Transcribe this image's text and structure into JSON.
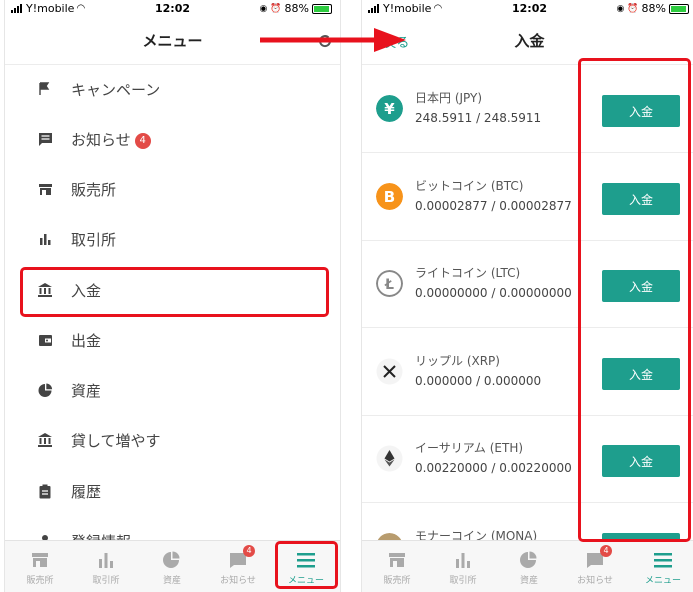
{
  "status": {
    "carrier": "Y!mobile",
    "time": "12:02",
    "battery": "88%"
  },
  "left": {
    "title": "メニュー",
    "items": [
      {
        "label": "キャンペーン",
        "icon": "flag-icon"
      },
      {
        "label": "お知らせ",
        "icon": "message-icon",
        "badge": "4"
      },
      {
        "label": "販売所",
        "icon": "store-icon"
      },
      {
        "label": "取引所",
        "icon": "bar-chart-icon"
      },
      {
        "label": "入金",
        "icon": "bank-icon"
      },
      {
        "label": "出金",
        "icon": "wallet-icon"
      },
      {
        "label": "資産",
        "icon": "pie-chart-icon"
      },
      {
        "label": "貸して増やす",
        "icon": "bank-icon"
      },
      {
        "label": "履歴",
        "icon": "clipboard-icon"
      },
      {
        "label": "登録情報",
        "icon": "person-icon"
      }
    ]
  },
  "right": {
    "back": "戻る",
    "title": "入金",
    "coins": [
      {
        "name": "日本円 (JPY)",
        "balance": "248.5911 / 248.5911",
        "button": "入金",
        "icon": "yen-icon",
        "color": "#1e9e8d"
      },
      {
        "name": "ビットコイン (BTC)",
        "balance": "0.00002877 / 0.00002877",
        "button": "入金",
        "icon": "bitcoin-icon",
        "color": "#f7931a"
      },
      {
        "name": "ライトコイン (LTC)",
        "balance": "0.00000000 / 0.00000000",
        "button": "入金",
        "icon": "litecoin-icon",
        "color": "#888888"
      },
      {
        "name": "リップル (XRP)",
        "balance": "0.000000 / 0.000000",
        "button": "入金",
        "icon": "xrp-icon",
        "color": "#222222"
      },
      {
        "name": "イーサリアム (ETH)",
        "balance": "0.00220000 / 0.00220000",
        "button": "入金",
        "icon": "ethereum-icon",
        "color": "#444444"
      },
      {
        "name": "モナーコイン (MONA)",
        "balance": "",
        "button": "入金",
        "icon": "monacoin-icon",
        "color": "#b89c6e"
      }
    ]
  },
  "tabs": [
    {
      "label": "販売所",
      "icon": "store-icon"
    },
    {
      "label": "取引所",
      "icon": "bar-chart-icon"
    },
    {
      "label": "資産",
      "icon": "pie-chart-icon"
    },
    {
      "label": "お知らせ",
      "icon": "message-icon",
      "badge": "4"
    },
    {
      "label": "メニュー",
      "icon": "menu-icon",
      "active": true
    }
  ],
  "colors": {
    "accent": "#1e9e8d",
    "highlight": "#e8121d",
    "badge": "#e34b47"
  }
}
